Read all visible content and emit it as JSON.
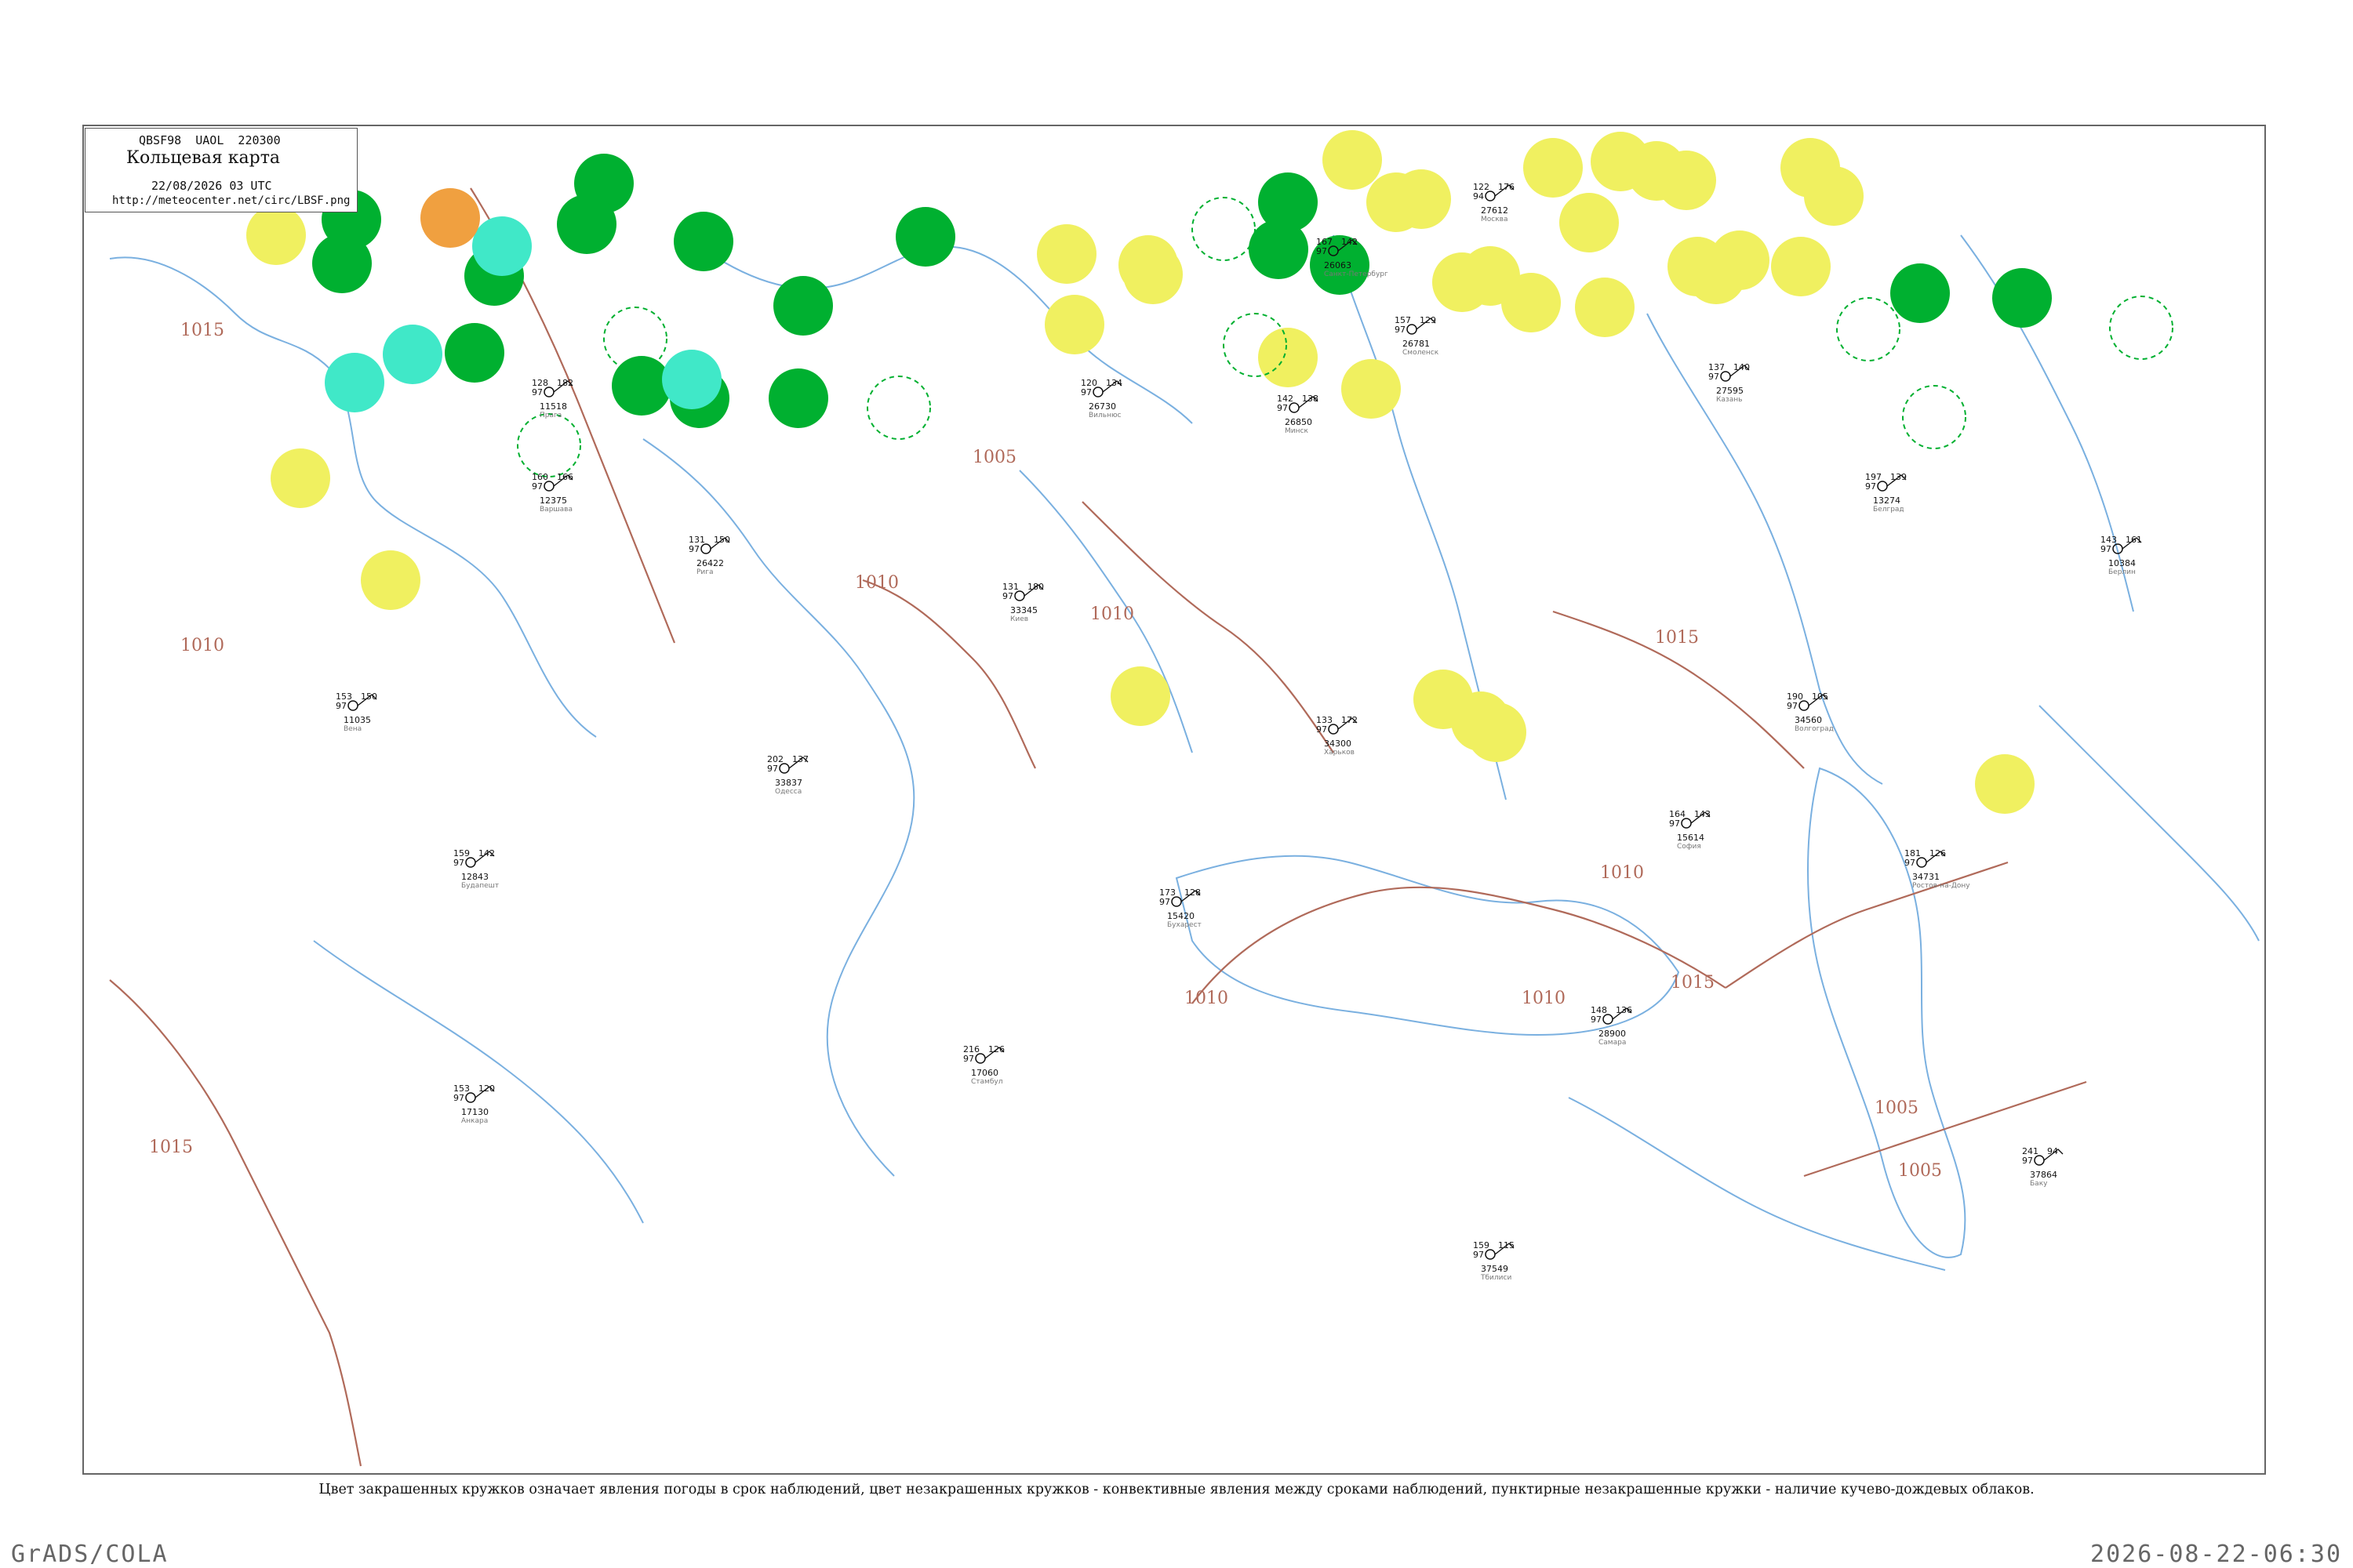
{
  "header": {
    "code": "QBSF98  UAOL  220300",
    "title": "Кольцевая карта",
    "datetime": "22/08/2026 03 UTC",
    "url": "http://meteocenter.net/circ/LBSF.png"
  },
  "caption": "Цвет закрашенных кружков означает явления погоды в срок наблюдений, цвет незакрашенных кружков - конвективные явления между сроками наблюдений, пунктирные незакрашенные кружки - наличие кучево-дождевых облаков.",
  "footer": {
    "left": "GrADS/COLA",
    "right": "2026-08-22-06:30"
  },
  "colors": {
    "rain": "#00b030",
    "drizzle": "#40e8c8",
    "haze": "#f0f060",
    "fog": "#f0a040",
    "pressure_contour": "#b06a5a",
    "water": "#7ab0e0",
    "borders": "#a0a0a0"
  },
  "isobars": [
    "1015",
    "1010",
    "1010",
    "1010",
    "1015",
    "1005",
    "1010",
    "1015",
    "1015",
    "1010",
    "1005",
    "1010",
    "1005"
  ],
  "stations": [
    {
      "name": "Москва",
      "id": "27612",
      "t": "122",
      "d": "94",
      "p": "176"
    },
    {
      "name": "Смоленск",
      "id": "26781",
      "t": "157",
      "d": "97",
      "p": "129"
    },
    {
      "name": "Минск",
      "id": "26850",
      "t": "142",
      "d": "97",
      "p": "138"
    },
    {
      "name": "Киев",
      "id": "33345",
      "t": "131",
      "d": "97",
      "p": "180"
    },
    {
      "name": "Харьков",
      "id": "34300",
      "t": "133",
      "d": "97",
      "p": "172"
    },
    {
      "name": "Одесса",
      "id": "33837",
      "t": "202",
      "d": "97",
      "p": "137"
    },
    {
      "name": "Варшава",
      "id": "12375",
      "t": "160",
      "d": "97",
      "p": "166"
    },
    {
      "name": "Вильнюс",
      "id": "26730",
      "t": "120",
      "d": "97",
      "p": "134"
    },
    {
      "name": "Рига",
      "id": "26422",
      "t": "131",
      "d": "97",
      "p": "150"
    },
    {
      "name": "Санкт-Петербург",
      "id": "26063",
      "t": "167",
      "d": "97",
      "p": "142"
    },
    {
      "name": "Волгоград",
      "id": "34560",
      "t": "190",
      "d": "97",
      "p": "105"
    },
    {
      "name": "Ростов-на-Дону",
      "id": "34731",
      "t": "181",
      "d": "97",
      "p": "126"
    },
    {
      "name": "Самара",
      "id": "28900",
      "t": "148",
      "d": "97",
      "p": "136"
    },
    {
      "name": "Казань",
      "id": "27595",
      "t": "137",
      "d": "97",
      "p": "140"
    },
    {
      "name": "Бухарест",
      "id": "15420",
      "t": "173",
      "d": "97",
      "p": "128"
    },
    {
      "name": "Анкара",
      "id": "17130",
      "t": "153",
      "d": "97",
      "p": "120"
    },
    {
      "name": "Стамбул",
      "id": "17060",
      "t": "216",
      "d": "97",
      "p": "126"
    },
    {
      "name": "Тбилиси",
      "id": "37549",
      "t": "159",
      "d": "97",
      "p": "115"
    },
    {
      "name": "Баку",
      "id": "37864",
      "t": "241",
      "d": "97",
      "p": "94"
    },
    {
      "name": "Будапешт",
      "id": "12843",
      "t": "159",
      "d": "97",
      "p": "142"
    },
    {
      "name": "Вена",
      "id": "11035",
      "t": "153",
      "d": "97",
      "p": "150"
    },
    {
      "name": "Прага",
      "id": "11518",
      "t": "128",
      "d": "97",
      "p": "182"
    },
    {
      "name": "Берлин",
      "id": "10384",
      "t": "143",
      "d": "97",
      "p": "161"
    },
    {
      "name": "Белград",
      "id": "13274",
      "t": "197",
      "d": "97",
      "p": "139"
    },
    {
      "name": "София",
      "id": "15614",
      "t": "164",
      "d": "97",
      "p": "143"
    }
  ]
}
